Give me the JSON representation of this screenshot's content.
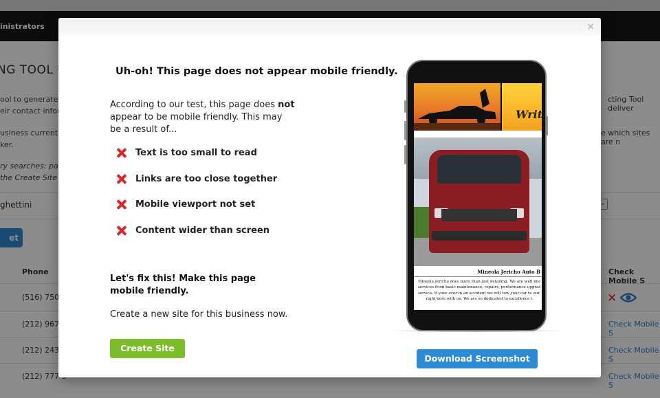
{
  "background": {
    "nav_item": "inistrators",
    "page_title": "NG TOOL *",
    "text_lines": [
      "ool to generate mo",
      "eir contact inform",
      "usiness currently",
      "ker.",
      "cting Tool deliver",
      "e which sites are n"
    ],
    "italic_lines": [
      "ry searches: paint",
      " the Create Site pa"
    ],
    "input_value": "ghettini",
    "button_label": "et",
    "columns": {
      "phone": "Phone",
      "check_mobile": "Check Mobile S"
    },
    "rows": [
      {
        "phone": "(516) 750-8",
        "check": ""
      },
      {
        "phone": "(212) 967-9",
        "check": "Check Mobile S"
      },
      {
        "phone": "(212) 243-4",
        "check": "Check Mobile S"
      },
      {
        "phone": "(212) 777-5",
        "check": "Check Mobile S"
      }
    ]
  },
  "modal": {
    "close_glyph": "×",
    "title": "Uh-oh! This page does not appear mobile friendly.",
    "intro_pre": "According to our test, this page does ",
    "intro_bold": "not",
    "intro_post": " appear to be mobile friendly. This may be a result of...",
    "issues": [
      "Text is too small to read",
      "Links are too close together",
      "Mobile viewport not set",
      "Content wider than screen"
    ],
    "fix_text": "Let's fix this! Make this page mobile friendly.",
    "create_text": "Create a new site for this business now.",
    "create_button": "Create Site",
    "download_button": "Download Screenshot",
    "preview": {
      "header_word": "Writ",
      "business_title": "Mineola Jericho Auto B",
      "description_lines": [
        "Mineola Jericho does more than just detailing. We are well know",
        "services from basic maintenance, repairs, performance upgrade",
        "service. If your ever in an accident we will tow your car to our s",
        "right here with us. We are so dedicated to excellence t"
      ]
    }
  },
  "colors": {
    "error_red": "#d9272e",
    "create_green": "#7cbd2a",
    "download_blue": "#2d8bd6",
    "link_blue": "#2d7fc9"
  }
}
